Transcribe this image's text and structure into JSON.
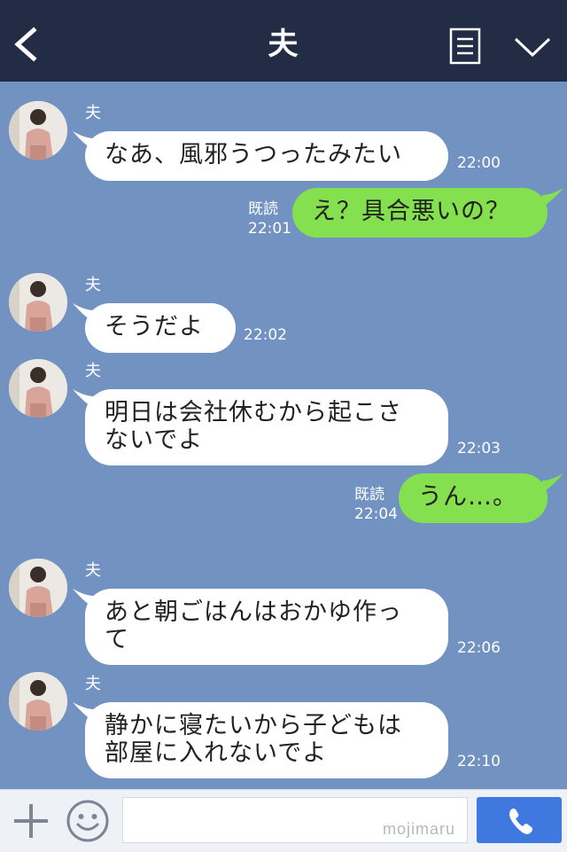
{
  "header": {
    "title": "夫"
  },
  "chat": {
    "messages": [
      {
        "from": "夫",
        "text": "なあ、風邪うつったみたい",
        "time": "22:00"
      },
      {
        "text": "え？具合悪いの？",
        "read": "既読",
        "time": "22:01"
      },
      {
        "from": "夫",
        "text": "そうだよ",
        "time": "22:02"
      },
      {
        "from": "夫",
        "text": "明日は会社休むから起こさ\nないでよ",
        "time": "22:03"
      },
      {
        "text": "うん…。",
        "read": "既読",
        "time": "22:04"
      },
      {
        "from": "夫",
        "text": "あと朝ごはんはおかゆ作っ\nて",
        "time": "22:06"
      },
      {
        "from": "夫",
        "text": "静かに寝たいから子どもは\n部屋に入れないでよ",
        "time": "22:10"
      }
    ]
  },
  "input_bar": {
    "placeholder": "",
    "watermark": "mojimaru"
  },
  "icons": {
    "back": "chevron-left-icon",
    "menu": "note-list-icon",
    "collapse": "chevron-down-icon",
    "plus": "plus-icon",
    "emoji": "smiley-icon",
    "call": "phone-icon"
  },
  "colors": {
    "header_bg": "#232c45",
    "chat_bg": "#7292c2",
    "incoming_bubble": "#ffffff",
    "outgoing_bubble": "#84e04e",
    "call_button": "#3f79e0"
  }
}
